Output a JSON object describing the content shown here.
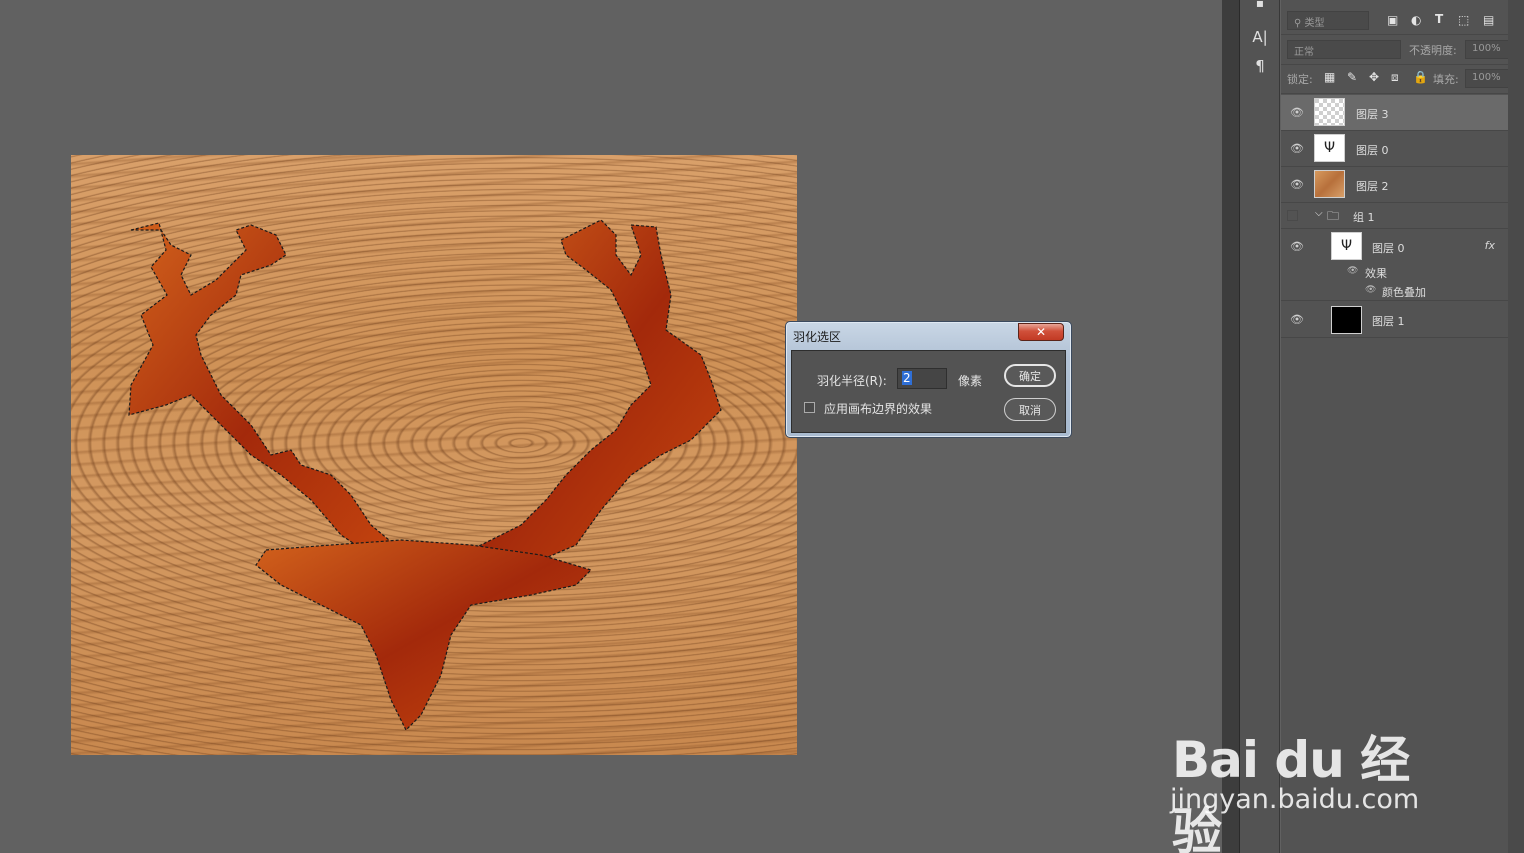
{
  "dialog": {
    "title": "羽化选区",
    "close_label": "✕",
    "radius_label": "羽化半径(R):",
    "radius_value": "2",
    "unit_label": "像素",
    "apply_edge_label": "应用画布边界的效果",
    "apply_edge_checked": false,
    "ok_label": "确定",
    "cancel_label": "取消"
  },
  "tools": [
    "A|",
    "¶"
  ],
  "layers_panel": {
    "filter_placeholder": "类型",
    "blend_mode": "正常",
    "opacity_label": "不透明度:",
    "opacity_value": "100%",
    "lock_label": "锁定:",
    "fill_label": "填充:",
    "fill_value": "100%",
    "layers": [
      {
        "name": "图层 3",
        "visible": true,
        "selected": true
      },
      {
        "name": "图层 0",
        "visible": true
      },
      {
        "name": "图层 2",
        "visible": true
      },
      {
        "name": "组 1",
        "visible": false,
        "group": true
      },
      {
        "name": "图层 0",
        "visible": true,
        "fx": "fx"
      },
      {
        "name": "效果",
        "visible": true
      },
      {
        "name": "颜色叠加",
        "visible": true
      },
      {
        "name": "图层 1",
        "visible": true
      }
    ]
  },
  "watermark": {
    "logo": "Bai du 经验",
    "url": "jingyan.baidu.com"
  }
}
